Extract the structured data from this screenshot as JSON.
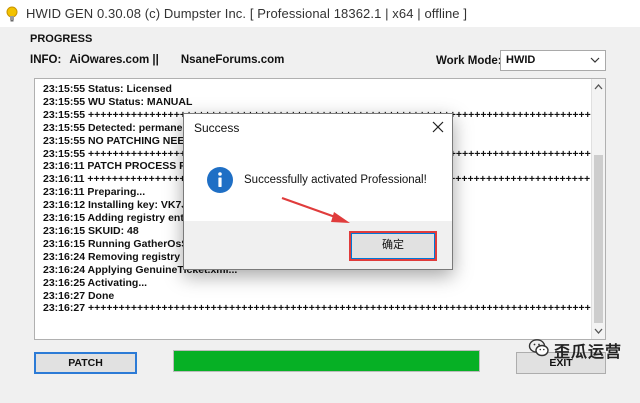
{
  "window": {
    "title": "HWID GEN 0.30.08 (c) Dumpster Inc. [ Professional 18362.1 | x64 | offline ]"
  },
  "progress_group": {
    "label": "PROGRESS",
    "info_label": "INFO:",
    "link1": "AiOwares.com ||",
    "link2": "NsaneForums.com",
    "work_mode_label": "Work Mode:",
    "work_mode_value": "HWID"
  },
  "log": {
    "lines": [
      "23:15:55 Status: Licensed",
      "23:15:55 WU Status: MANUAL",
      "23:15:55 ++++++++++++++++++++++++++++++++++++++++++++++++++++++++++++++++++++++++++++++++++",
      "23:15:55 Detected: permane",
      "23:15:55 NO PATCHING NEEDE",
      "23:15:55 ++++++++++++++++++++++++++++++++++++++++++++++++++++++++++++++++++++++++++++++++++",
      "23:16:11 PATCH PROCESS PR",
      "23:16:11 ++++++++++++++++++++++++++++++++++++++++++++++++++++++++++++++++++++++++++++++++++",
      "23:16:11 Preparing...",
      "23:16:12 Installing key: VK7J",
      "23:16:15 Adding registry ent",
      "23:16:15 SKUID: 48",
      "23:16:15 Running GatherOsS",
      "23:16:24 Removing registry",
      "23:16:24 Applying GenuineTicket.xml...",
      "23:16:25 Activating...",
      "23:16:27 Done",
      "23:16:27 ++++++++++++++++++++++++++++++++++++++++++++++++++++++++++++++++++++++++++++++++++"
    ]
  },
  "buttons": {
    "patch": "PATCH",
    "exit": "EXIT"
  },
  "progress_bar": {
    "percent": 100,
    "color": "#06b025"
  },
  "dialog": {
    "title": "Success",
    "message": "Successfully activated Professional!",
    "ok_label": "确定",
    "icon": "info-icon",
    "highlight_color": "#e03c3c"
  },
  "watermark": {
    "text": "歪瓜运营",
    "icon": "wechat-icon"
  }
}
